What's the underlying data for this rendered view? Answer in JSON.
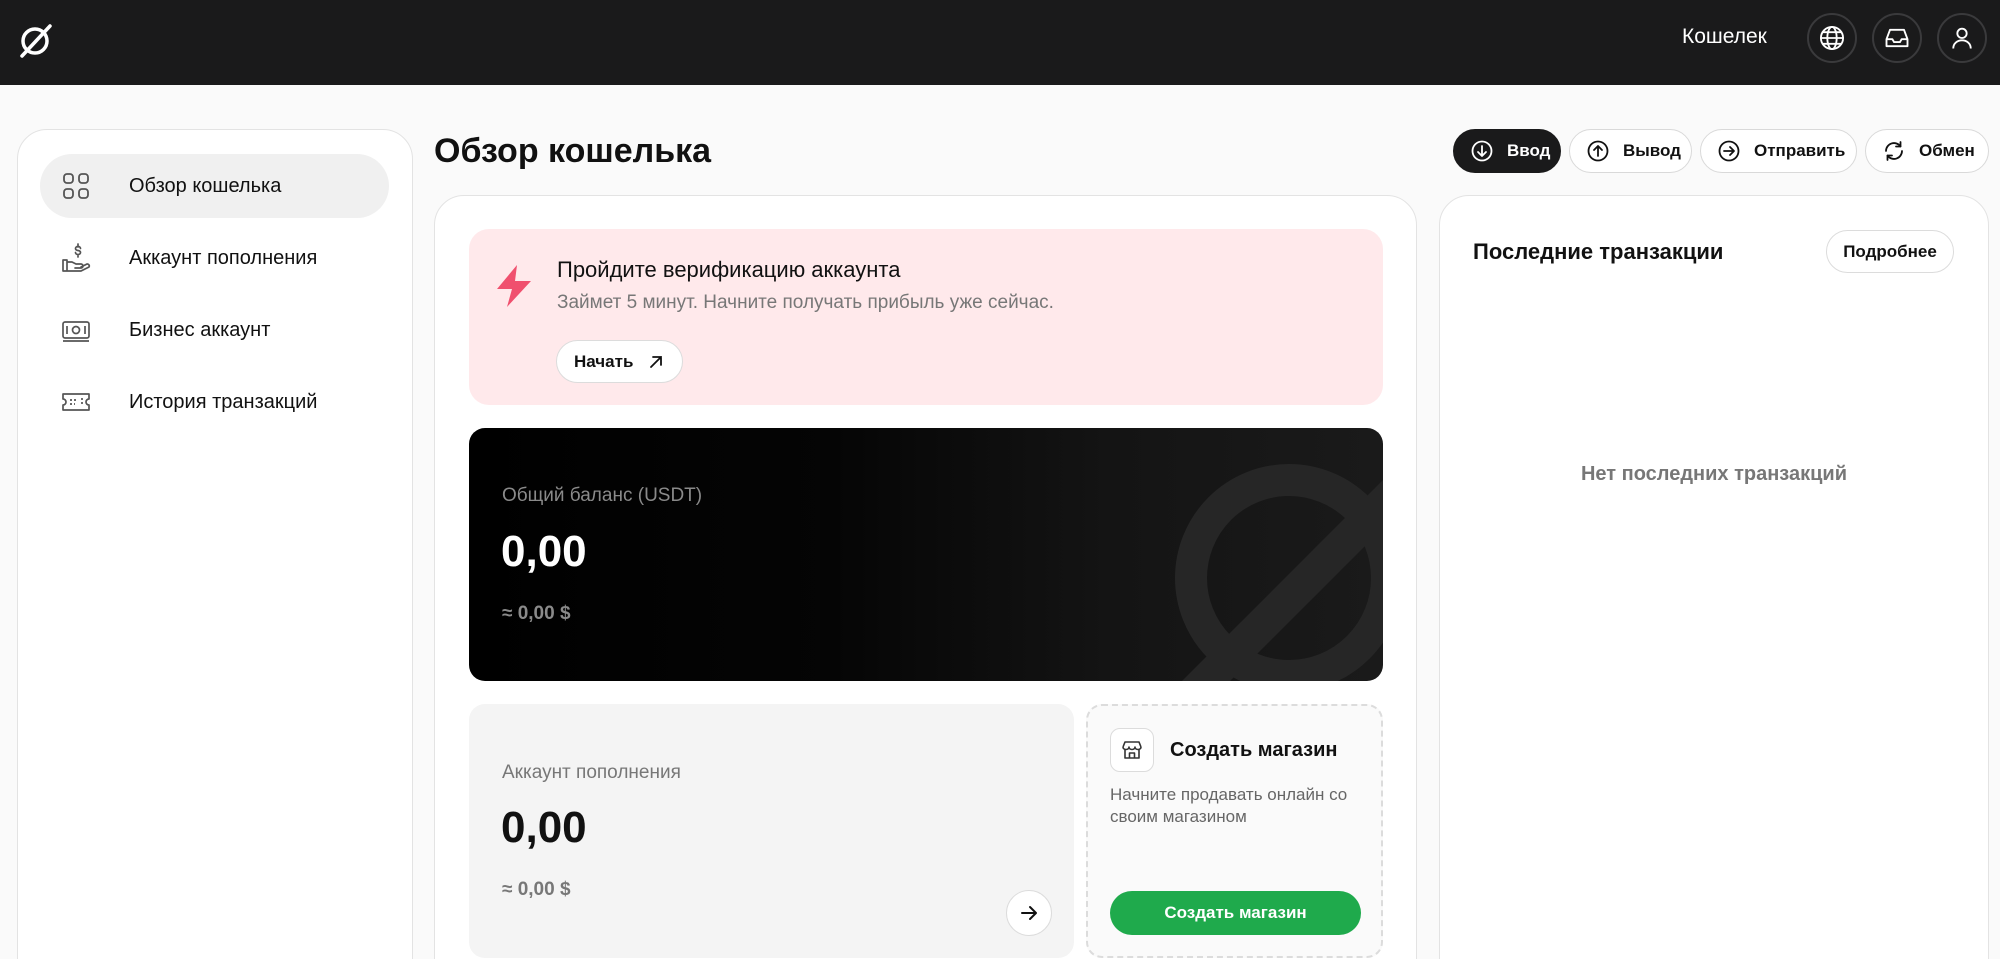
{
  "header": {
    "wallet_label": "Кошелек",
    "icons": [
      "globe-icon",
      "inbox-icon",
      "user-icon"
    ]
  },
  "sidebar": {
    "items": [
      {
        "label": "Обзор кошелька",
        "icon": "grid-icon",
        "active": true
      },
      {
        "label": "Аккаунт пополнения",
        "icon": "hand-dollar-icon",
        "active": false
      },
      {
        "label": "Бизнес аккаунт",
        "icon": "cash-icon",
        "active": false
      },
      {
        "label": "История транзакций",
        "icon": "ticket-icon",
        "active": false
      }
    ]
  },
  "page": {
    "title": "Обзор кошелька"
  },
  "actions": {
    "deposit": "Ввод",
    "withdraw": "Вывод",
    "send": "Отправить",
    "exchange": "Обмен"
  },
  "verification": {
    "title": "Пройдите верификацию аккаунта",
    "subtitle": "Займет 5 минут. Начните получать прибыль уже сейчас.",
    "button": "Начать"
  },
  "balance": {
    "label": "Общий баланс (USDT)",
    "value": "0,00",
    "usd": "≈ 0,00 $"
  },
  "topup": {
    "label": "Аккаунт пополнения",
    "value": "0,00",
    "usd": "≈ 0,00 $"
  },
  "shop": {
    "title": "Создать магазин",
    "description": "Начните продавать онлайн со своим магазином",
    "button": "Создать магазин"
  },
  "transactions": {
    "title": "Последние транзакции",
    "more_button": "Подробнее",
    "empty_text": "Нет последних транзакций"
  },
  "colors": {
    "topbar": "#1a1a1b",
    "accent_green": "#1faa4c",
    "verify_bg": "#ffe9eb",
    "verify_icon": "#f0506e"
  }
}
